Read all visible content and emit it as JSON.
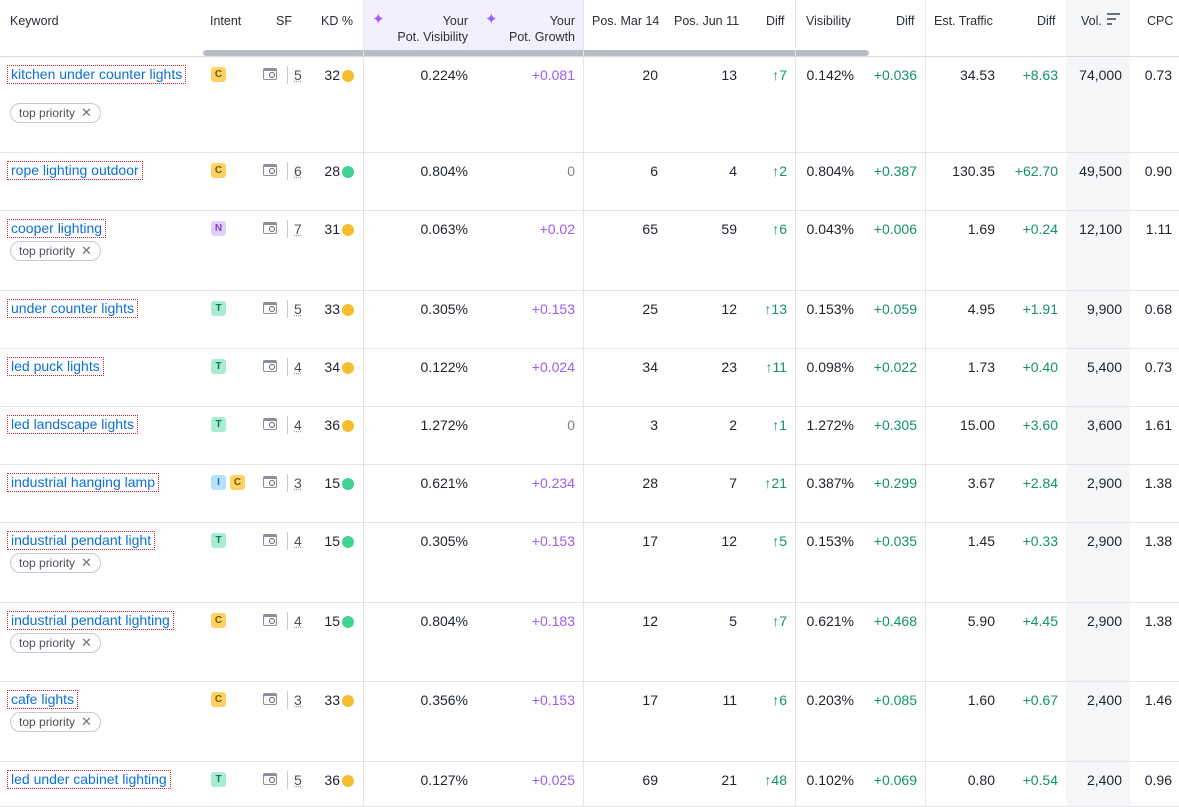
{
  "header": {
    "keyword": "Keyword",
    "intent": "Intent",
    "sf": "SF",
    "kd": "KD %",
    "pot_visibility_1": "Your",
    "pot_visibility_2": "Pot. Visibility",
    "pot_growth_1": "Your",
    "pot_growth_2": "Pot. Growth",
    "pos_mar": "Pos. Mar 14",
    "pos_jun": "Pos. Jun 11",
    "diff": "Diff",
    "visibility": "Visibility",
    "diff2": "Diff",
    "est_traffic": "Est. Traffic",
    "diff3": "Diff",
    "vol": "Vol.",
    "cpc": "CPC",
    "sparkle_icon": "✦"
  },
  "colors": {
    "accent_purple": "#9d5cf5",
    "link_blue": "#0b6fd6",
    "kd_yellow": "#f5be2e",
    "kd_green": "#3fd492",
    "positive_green": "#139463"
  },
  "icons": {
    "serp": "serp-features-icon",
    "sort": "sort-icon",
    "sparkle": "sparkle-icon",
    "close": "close-icon"
  },
  "rows": [
    {
      "keyword": "kitchen under counter lights",
      "tag": "top priority",
      "intent": [
        "C"
      ],
      "sf": "5",
      "kd": "32",
      "kd_color": "#f5be2e",
      "pot_vis": "0.224%",
      "pot_growth": "+0.081",
      "pos_mar": "20",
      "pos_jun": "13",
      "diff": "↑7",
      "visibility": "0.142%",
      "vis_diff": "+0.036",
      "traffic": "34.53",
      "traffic_diff": "+8.63",
      "vol": "74,000",
      "cpc": "0.73"
    },
    {
      "keyword": "rope lighting outdoor",
      "tag": "",
      "intent": [
        "C"
      ],
      "sf": "6",
      "kd": "28",
      "kd_color": "#3fd492",
      "pot_vis": "0.804%",
      "pot_growth": "0",
      "pos_mar": "6",
      "pos_jun": "4",
      "diff": "↑2",
      "visibility": "0.804%",
      "vis_diff": "+0.387",
      "traffic": "130.35",
      "traffic_diff": "+62.70",
      "vol": "49,500",
      "cpc": "0.90"
    },
    {
      "keyword": "cooper lighting",
      "tag": "top priority",
      "intent": [
        "N"
      ],
      "sf": "7",
      "kd": "31",
      "kd_color": "#f5be2e",
      "pot_vis": "0.063%",
      "pot_growth": "+0.02",
      "pos_mar": "65",
      "pos_jun": "59",
      "diff": "↑6",
      "visibility": "0.043%",
      "vis_diff": "+0.006",
      "traffic": "1.69",
      "traffic_diff": "+0.24",
      "vol": "12,100",
      "cpc": "1.11"
    },
    {
      "keyword": "under counter lights",
      "tag": "",
      "intent": [
        "T"
      ],
      "sf": "5",
      "kd": "33",
      "kd_color": "#f5be2e",
      "pot_vis": "0.305%",
      "pot_growth": "+0.153",
      "pos_mar": "25",
      "pos_jun": "12",
      "diff": "↑13",
      "visibility": "0.153%",
      "vis_diff": "+0.059",
      "traffic": "4.95",
      "traffic_diff": "+1.91",
      "vol": "9,900",
      "cpc": "0.68"
    },
    {
      "keyword": "led puck lights",
      "tag": "",
      "intent": [
        "T"
      ],
      "sf": "4",
      "kd": "34",
      "kd_color": "#f5be2e",
      "pot_vis": "0.122%",
      "pot_growth": "+0.024",
      "pos_mar": "34",
      "pos_jun": "23",
      "diff": "↑11",
      "visibility": "0.098%",
      "vis_diff": "+0.022",
      "traffic": "1.73",
      "traffic_diff": "+0.40",
      "vol": "5,400",
      "cpc": "0.73"
    },
    {
      "keyword": "led landscape lights",
      "tag": "",
      "intent": [
        "T"
      ],
      "sf": "4",
      "kd": "36",
      "kd_color": "#f5be2e",
      "pot_vis": "1.272%",
      "pot_growth": "0",
      "pos_mar": "3",
      "pos_jun": "2",
      "diff": "↑1",
      "visibility": "1.272%",
      "vis_diff": "+0.305",
      "traffic": "15.00",
      "traffic_diff": "+3.60",
      "vol": "3,600",
      "cpc": "1.61"
    },
    {
      "keyword": "industrial hanging lamp",
      "tag": "",
      "intent": [
        "I",
        "C"
      ],
      "sf": "3",
      "kd": "15",
      "kd_color": "#3fd492",
      "pot_vis": "0.621%",
      "pot_growth": "+0.234",
      "pos_mar": "28",
      "pos_jun": "7",
      "diff": "↑21",
      "visibility": "0.387%",
      "vis_diff": "+0.299",
      "traffic": "3.67",
      "traffic_diff": "+2.84",
      "vol": "2,900",
      "cpc": "1.38"
    },
    {
      "keyword": "industrial pendant light",
      "tag": "top priority",
      "intent": [
        "T"
      ],
      "sf": "4",
      "kd": "15",
      "kd_color": "#3fd492",
      "pot_vis": "0.305%",
      "pot_growth": "+0.153",
      "pos_mar": "17",
      "pos_jun": "12",
      "diff": "↑5",
      "visibility": "0.153%",
      "vis_diff": "+0.035",
      "traffic": "1.45",
      "traffic_diff": "+0.33",
      "vol": "2,900",
      "cpc": "1.38"
    },
    {
      "keyword": "industrial pendant lighting",
      "tag": "top priority",
      "intent": [
        "C"
      ],
      "sf": "4",
      "kd": "15",
      "kd_color": "#3fd492",
      "pot_vis": "0.804%",
      "pot_growth": "+0.183",
      "pos_mar": "12",
      "pos_jun": "5",
      "diff": "↑7",
      "visibility": "0.621%",
      "vis_diff": "+0.468",
      "traffic": "5.90",
      "traffic_diff": "+4.45",
      "vol": "2,900",
      "cpc": "1.38"
    },
    {
      "keyword": "cafe lights",
      "tag": "top priority",
      "intent": [
        "C"
      ],
      "sf": "3",
      "kd": "33",
      "kd_color": "#f5be2e",
      "pot_vis": "0.356%",
      "pot_growth": "+0.153",
      "pos_mar": "17",
      "pos_jun": "11",
      "diff": "↑6",
      "visibility": "0.203%",
      "vis_diff": "+0.085",
      "traffic": "1.60",
      "traffic_diff": "+0.67",
      "vol": "2,400",
      "cpc": "1.46"
    },
    {
      "keyword": "led under cabinet lighting",
      "tag": "",
      "intent": [
        "T"
      ],
      "sf": "5",
      "kd": "36",
      "kd_color": "#f5be2e",
      "pot_vis": "0.127%",
      "pot_growth": "+0.025",
      "pos_mar": "69",
      "pos_jun": "21",
      "diff": "↑48",
      "visibility": "0.102%",
      "vis_diff": "+0.069",
      "traffic": "0.80",
      "traffic_diff": "+0.54",
      "vol": "2,400",
      "cpc": "0.96"
    }
  ]
}
